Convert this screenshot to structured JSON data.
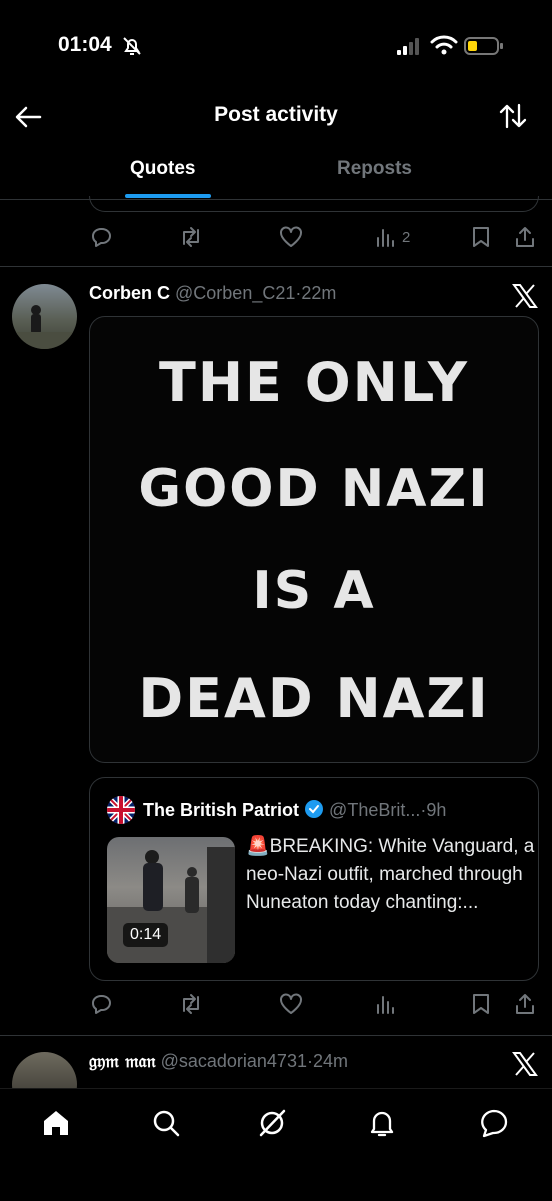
{
  "status_bar": {
    "time": "01:04",
    "icons": [
      "bell-slash-icon",
      "signal-icon",
      "wifi-icon",
      "battery-icon"
    ]
  },
  "header": {
    "back_icon": "arrow-left-icon",
    "title": "Post activity",
    "sort_icon": "sort-arrows-icon"
  },
  "tabs": [
    {
      "label": "Quotes",
      "active": true
    },
    {
      "label": "Reposts",
      "active": false
    }
  ],
  "top_actions": {
    "views": "2"
  },
  "post1": {
    "name": "Corben C",
    "handle": "@Corben_C21",
    "dot": "·",
    "time": "22m",
    "platform_icon": "x-logo-icon",
    "image_text_lines": [
      "THE ONLY",
      "GOOD NAZI",
      "IS A",
      "DEAD NAZI"
    ],
    "quoted": {
      "name": "The British Patriot",
      "handle": "@TheBrit...",
      "dot": "·",
      "time": "9h",
      "verified": true,
      "video_duration": "0:14",
      "text": "🚨BREAKING: White Vanguard, a neo-Nazi outfit, marched through Nuneaton today chanting:..."
    }
  },
  "post2": {
    "name": "𝔤𝔶𝔪 𝔪𝔞𝔫",
    "handle": "@sacadorian4731",
    "dot": "·",
    "time": "24m",
    "platform_icon": "x-logo-icon"
  },
  "bottom_nav": [
    "home-icon",
    "search-icon",
    "grok-icon",
    "notifications-icon",
    "messages-icon"
  ],
  "colors": {
    "background": "#000000",
    "accent": "#1d9bf0",
    "muted": "#71767b",
    "text": "#e7e9ea"
  }
}
